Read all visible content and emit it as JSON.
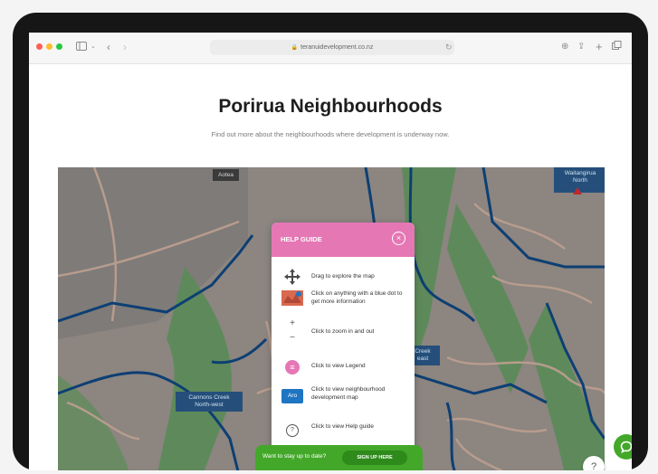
{
  "browser": {
    "url": "teranuidevelopment.co.nz",
    "icons": {
      "sidebar": "sidebar-icon",
      "back": "back-icon",
      "forward": "forward-icon",
      "reload": "reload-icon",
      "download": "download-icon",
      "share": "share-icon",
      "new_tab": "plus-icon",
      "tabs": "tabs-icon"
    }
  },
  "page": {
    "title": "Porirua Neighbourhoods",
    "subtitle": "Find out more about the neighbourhoods where development is underway now."
  },
  "map": {
    "labels": {
      "aotea": "Aotea",
      "waitangirua": "Waitangirua",
      "waitangirua_rest": "North",
      "creek": "Creek",
      "creek_rest": "east",
      "cannons_1": "Cannons Creek",
      "cannons_2": "North-west"
    }
  },
  "help_guide": {
    "title": "HELP GUIDE",
    "items": [
      {
        "icon": "move-icon",
        "text": "Drag to explore the map"
      },
      {
        "icon": "blue-dot-icon",
        "text": "Click on anything with a blue dot to get more information"
      },
      {
        "icon": "zoom-icon",
        "plus": "+",
        "minus": "−",
        "text": "Click to zoom in and out"
      },
      {
        "icon": "legend-icon",
        "symbol": "≡",
        "text": "Click to view Legend"
      },
      {
        "icon": "aro-icon",
        "symbol": "Aro",
        "text": "Click to view neighbourhood development map"
      },
      {
        "icon": "help-icon",
        "symbol": "?",
        "text": "Click to view Help guide"
      }
    ]
  },
  "footer_bar": {
    "text": "Want to stay up to date?",
    "button": "SIGN UP HERE"
  },
  "colors": {
    "help_header": "#e577b5",
    "map_bg": "#8c8580",
    "road_blue": "#0d3f73",
    "park_green": "#5e8a5b",
    "cta_green": "#43a829"
  }
}
